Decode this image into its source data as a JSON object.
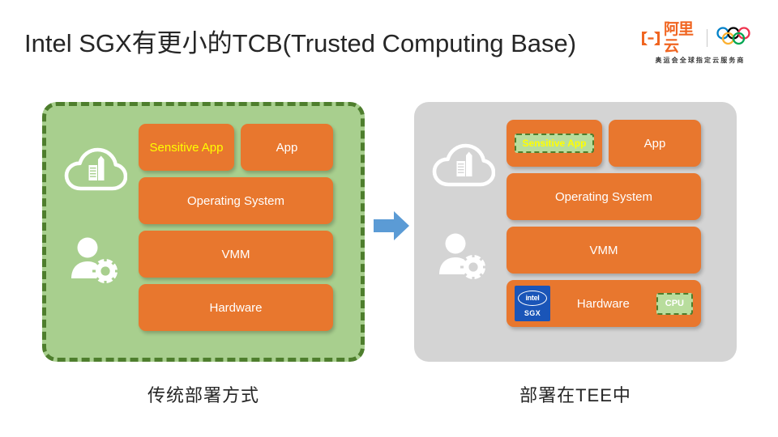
{
  "slide": {
    "title": "Intel SGX有更小的TCB(Trusted Computing Base)",
    "background": "#ffffff"
  },
  "brand": {
    "name": "阿里云",
    "tagline": "奥运会全球指定云服务商",
    "logo_icon": "alibaba-cloud-mark",
    "rings_icon": "olympic-rings-icon",
    "brand_color": "#f06521"
  },
  "colors": {
    "panel_traditional_fill": "#a8cf8e",
    "panel_traditional_border": "#4e7e2d",
    "panel_tee_fill": "#d4d4d4",
    "box_fill": "#e8772e",
    "box_text": "#ffffff",
    "sensitive_text": "#ffff00",
    "enclave_fill": "#b8dd9d",
    "enclave_border": "#4e7e2d",
    "intel_blue": "#1a55b8",
    "arrow_blue": "#5b9bd5"
  },
  "panels": {
    "traditional": {
      "caption": "传统部署方式",
      "icons": [
        {
          "name": "cloud-building-icon"
        },
        {
          "name": "user-gear-icon"
        }
      ],
      "stack": [
        {
          "id": "sensitive-app",
          "label": "Sensitive App",
          "highlight": true
        },
        {
          "id": "app",
          "label": "App",
          "highlight": false
        },
        {
          "id": "operating-system",
          "label": "Operating System",
          "highlight": false
        },
        {
          "id": "vmm",
          "label": "VMM",
          "highlight": false
        },
        {
          "id": "hardware",
          "label": "Hardware",
          "highlight": false
        }
      ]
    },
    "tee": {
      "caption": "部署在TEE中",
      "icons": [
        {
          "name": "cloud-building-icon"
        },
        {
          "name": "user-gear-icon"
        }
      ],
      "stack": [
        {
          "id": "sensitive-app",
          "label": "Sensitive App",
          "enclave": true
        },
        {
          "id": "app",
          "label": "App",
          "enclave": false
        },
        {
          "id": "operating-system",
          "label": "Operating System",
          "enclave": false
        },
        {
          "id": "vmm",
          "label": "VMM",
          "enclave": false
        },
        {
          "id": "hardware",
          "label": "Hardware",
          "enclave": false
        }
      ],
      "hardware_extras": {
        "intel_logo_word": "intel",
        "intel_logo_sub": "SGX",
        "cpu_badge": "CPU"
      }
    }
  },
  "arrow": {
    "name": "transition-arrow",
    "direction": "right"
  }
}
